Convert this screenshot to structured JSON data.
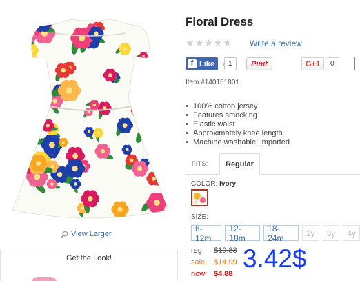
{
  "product": {
    "title": "Floral Dress",
    "review_link": "Write a review",
    "item_number": "Item #140151801",
    "view_larger": "View Larger",
    "get_the_look": "Get the Look!"
  },
  "rating": {
    "stars_filled": 0,
    "stars_total": 5
  },
  "social": {
    "fb_label": "Like",
    "fb_count": "1",
    "pinterest_label": "Pinit",
    "gplus_label": "G+1",
    "gplus_count": "0"
  },
  "features": [
    "100% cotton jersey",
    "Features smocking",
    "Elastic waist",
    "Approximately knee length",
    "Machine washable; imported"
  ],
  "fits": {
    "label": "FITS:",
    "selected": "Regular"
  },
  "color": {
    "label": "COLOR:",
    "value": "Ivory"
  },
  "size": {
    "label": "SIZE:",
    "options": [
      {
        "label": "6-12m",
        "available": true
      },
      {
        "label": "12-18m",
        "available": true
      },
      {
        "label": "18-24m",
        "available": true
      },
      {
        "label": "2y",
        "available": false
      },
      {
        "label": "3y",
        "available": false
      },
      {
        "label": "4y",
        "available": false
      }
    ]
  },
  "pricing": {
    "reg_label": "reg:",
    "reg_value": "$19.88",
    "sale_label": "sale:",
    "sale_value": "$14.99",
    "now_label": "now:",
    "now_value": "$4.88",
    "overlay_price": "3.42$"
  },
  "colors": {
    "link": "#3b6ea5",
    "sale": "#e0812b",
    "now": "#cc0000",
    "overlay": "#1a3cf0",
    "facebook": "#4267b2",
    "pinterest": "#cb2027"
  }
}
